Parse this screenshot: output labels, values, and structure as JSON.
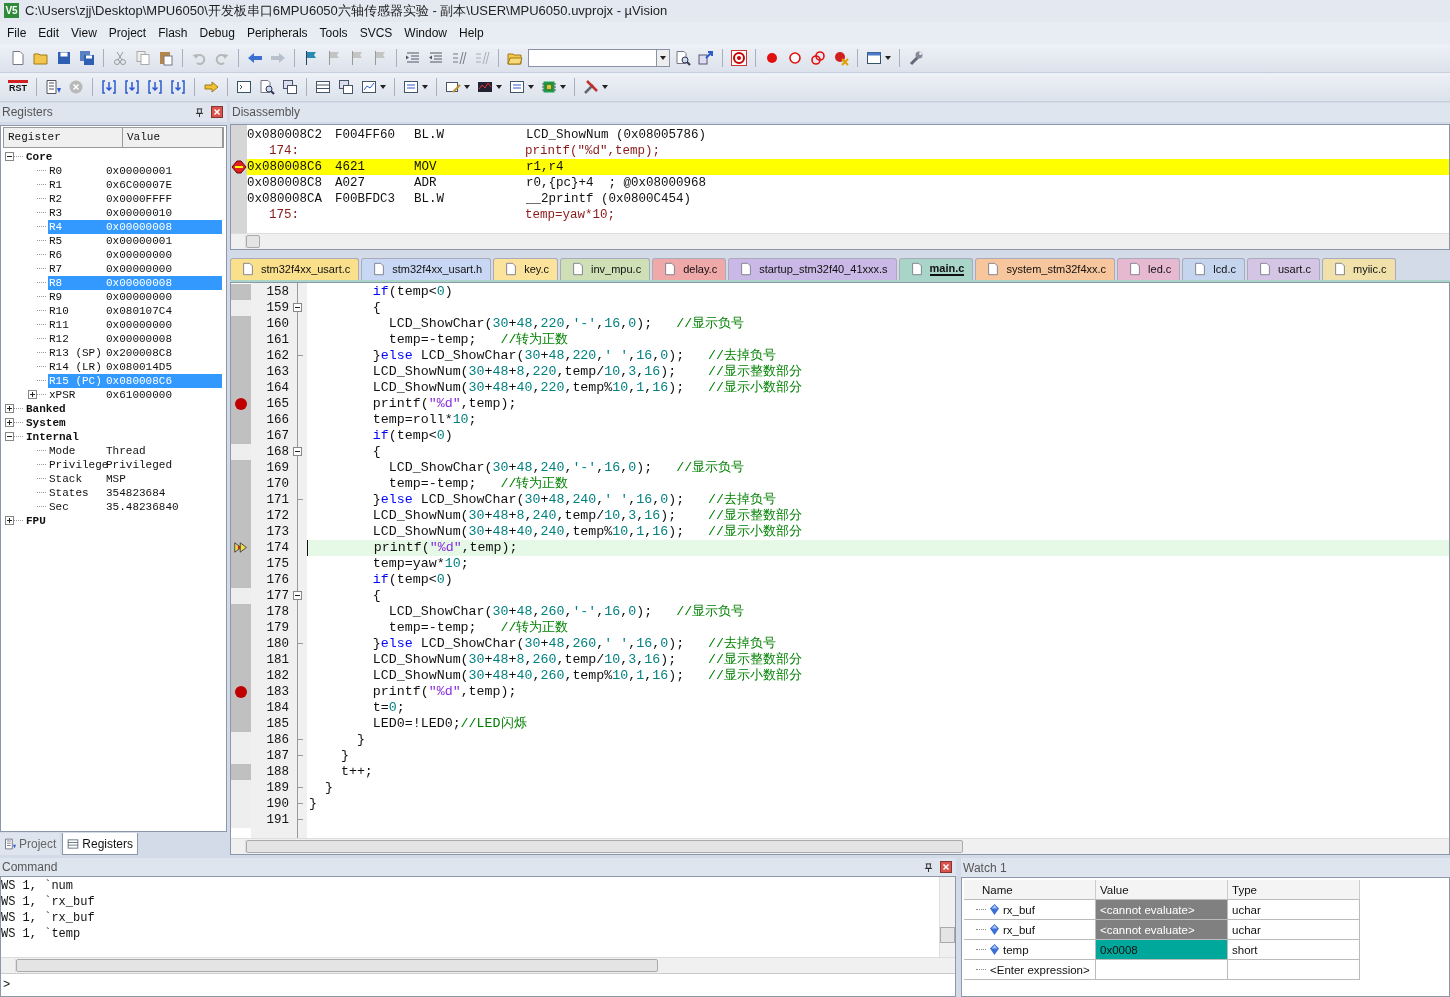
{
  "window": {
    "logo": "V5",
    "title": "C:\\Users\\zjj\\Desktop\\MPU6050\\开发板串口6MPU6050六轴传感器实验 - 副本\\USER\\MPU6050.uvprojx - µVision"
  },
  "menu": [
    "File",
    "Edit",
    "View",
    "Project",
    "Flash",
    "Debug",
    "Peripherals",
    "Tools",
    "SVCS",
    "Window",
    "Help"
  ],
  "toolbar_2": {
    "reset_label": "RST"
  },
  "registers_panel": {
    "title": "Registers",
    "columns": [
      "Register",
      "Value"
    ],
    "tree": [
      {
        "name": "Core",
        "expanded": true,
        "selected": false,
        "children": [
          {
            "name": "R0",
            "value": "0x00000001",
            "selected": false
          },
          {
            "name": "R1",
            "value": "0x6C00007E",
            "selected": false
          },
          {
            "name": "R2",
            "value": "0x0000FFFF",
            "selected": false
          },
          {
            "name": "R3",
            "value": "0x00000010",
            "selected": false
          },
          {
            "name": "R4",
            "value": "0x00000008",
            "selected": true
          },
          {
            "name": "R5",
            "value": "0x00000001",
            "selected": false
          },
          {
            "name": "R6",
            "value": "0x00000000",
            "selected": false
          },
          {
            "name": "R7",
            "value": "0x00000000",
            "selected": false
          },
          {
            "name": "R8",
            "value": "0x00000008",
            "selected": true
          },
          {
            "name": "R9",
            "value": "0x00000000",
            "selected": false
          },
          {
            "name": "R10",
            "value": "0x080107C4",
            "selected": false
          },
          {
            "name": "R11",
            "value": "0x00000000",
            "selected": false
          },
          {
            "name": "R12",
            "value": "0x00000008",
            "selected": false
          },
          {
            "name": "R13 (SP)",
            "value": "0x200008C8",
            "selected": false
          },
          {
            "name": "R14 (LR)",
            "value": "0x080014D5",
            "selected": false
          },
          {
            "name": "R15 (PC)",
            "value": "0x080008C6",
            "selected": true
          },
          {
            "name": "xPSR",
            "value": "0x61000000",
            "expanded": false,
            "selected": false
          }
        ]
      },
      {
        "name": "Banked",
        "expanded": false,
        "selected": false
      },
      {
        "name": "System",
        "expanded": false,
        "selected": false
      },
      {
        "name": "Internal",
        "expanded": true,
        "selected": false,
        "children": [
          {
            "name": "Mode",
            "value": "Thread",
            "selected": false
          },
          {
            "name": "Privilege",
            "value": "Privileged",
            "selected": false
          },
          {
            "name": "Stack",
            "value": "MSP",
            "selected": false
          },
          {
            "name": "States",
            "value": "354823684",
            "selected": false
          },
          {
            "name": "Sec",
            "value": "35.48236840",
            "selected": false
          }
        ]
      },
      {
        "name": "FPU",
        "expanded": false,
        "selected": false
      }
    ],
    "tabs": [
      {
        "label": "Project",
        "selected": false
      },
      {
        "label": "Registers",
        "selected": true
      }
    ]
  },
  "disassembly": {
    "title": "Disassembly",
    "rows": [
      {
        "kind": "asm",
        "address": "0x080008C2",
        "opcode": "F004FF60",
        "mnemonic": "BL.W",
        "operand": "LCD_ShowNum (0x08005786)",
        "current": false
      },
      {
        "kind": "source",
        "line": "174:",
        "text": "printf(\"%d\",temp);"
      },
      {
        "kind": "asm",
        "address": "0x080008C6",
        "opcode": "4621",
        "mnemonic": "MOV",
        "operand": "r1,r4",
        "current": true
      },
      {
        "kind": "asm",
        "address": "0x080008C8",
        "opcode": "A027",
        "mnemonic": "ADR",
        "operand": "r0,{pc}+4  ; @0x08000968",
        "current": false
      },
      {
        "kind": "asm",
        "address": "0x080008CA",
        "opcode": "F00BFDC3",
        "mnemonic": "BL.W",
        "operand": "__2printf (0x0800C454)",
        "current": false
      },
      {
        "kind": "source",
        "line": "175:",
        "text": "temp=yaw*10;"
      }
    ]
  },
  "editor": {
    "tabs": [
      {
        "label": "stm32f4xx_usart.c",
        "color": "#fbe08c",
        "selected": false
      },
      {
        "label": "stm32f4xx_usart.h",
        "color": "#c8d8f4",
        "selected": false
      },
      {
        "label": "key.c",
        "color": "#fce39c",
        "selected": false
      },
      {
        "label": "inv_mpu.c",
        "color": "#cfe0b6",
        "selected": false
      },
      {
        "label": "delay.c",
        "color": "#f0a9a9",
        "selected": false
      },
      {
        "label": "startup_stm32f40_41xxx.s",
        "color": "#cab9e6",
        "selected": false
      },
      {
        "label": "main.c",
        "color": "#a9d5c9",
        "selected": true
      },
      {
        "label": "system_stm32f4xx.c",
        "color": "#f8c69c",
        "selected": false
      },
      {
        "label": "led.c",
        "color": "#e6b9d1",
        "selected": false
      },
      {
        "label": "lcd.c",
        "color": "#c5d5ee",
        "selected": false
      },
      {
        "label": "usart.c",
        "color": "#d5c5e5",
        "selected": false
      },
      {
        "label": "myiic.c",
        "color": "#f0e1aa",
        "selected": false
      }
    ],
    "lines": [
      {
        "number": "158",
        "text": "        if(temp<0)",
        "executed": true,
        "breakpoint": false,
        "current": false
      },
      {
        "number": "159",
        "text": "        {",
        "executed": false,
        "breakpoint": false,
        "current": false,
        "fold_start": true
      },
      {
        "number": "160",
        "text": "          LCD_ShowChar(30+48,220,'-',16,0);   //显示负号",
        "executed": true,
        "breakpoint": false,
        "current": false
      },
      {
        "number": "161",
        "text": "          temp=-temp;   //转为正数",
        "executed": true,
        "breakpoint": false,
        "current": false
      },
      {
        "number": "162",
        "text": "        }else LCD_ShowChar(30+48,220,' ',16,0);   //去掉负号",
        "executed": true,
        "breakpoint": false,
        "current": false,
        "fold_end": true
      },
      {
        "number": "163",
        "text": "        LCD_ShowNum(30+48+8,220,temp/10,3,16);    //显示整数部分",
        "executed": true,
        "breakpoint": false,
        "current": false
      },
      {
        "number": "164",
        "text": "        LCD_ShowNum(30+48+40,220,temp%10,1,16);   //显示小数部分",
        "executed": true,
        "breakpoint": false,
        "current": false
      },
      {
        "number": "165",
        "text": "        printf(\"%d\",temp);",
        "executed": true,
        "breakpoint": true,
        "current": false
      },
      {
        "number": "166",
        "text": "        temp=roll*10;",
        "executed": true,
        "breakpoint": false,
        "current": false
      },
      {
        "number": "167",
        "text": "        if(temp<0)",
        "executed": true,
        "breakpoint": false,
        "current": false
      },
      {
        "number": "168",
        "text": "        {",
        "executed": false,
        "breakpoint": false,
        "current": false,
        "fold_start": true
      },
      {
        "number": "169",
        "text": "          LCD_ShowChar(30+48,240,'-',16,0);   //显示负号",
        "executed": true,
        "breakpoint": false,
        "current": false
      },
      {
        "number": "170",
        "text": "          temp=-temp;   //转为正数",
        "executed": true,
        "breakpoint": false,
        "current": false
      },
      {
        "number": "171",
        "text": "        }else LCD_ShowChar(30+48,240,' ',16,0);   //去掉负号",
        "executed": true,
        "breakpoint": false,
        "current": false,
        "fold_end": true
      },
      {
        "number": "172",
        "text": "        LCD_ShowNum(30+48+8,240,temp/10,3,16);    //显示整数部分",
        "executed": true,
        "breakpoint": false,
        "current": false
      },
      {
        "number": "173",
        "text": "        LCD_ShowNum(30+48+40,240,temp%10,1,16);   //显示小数部分",
        "executed": true,
        "breakpoint": false,
        "current": false
      },
      {
        "number": "174",
        "text": "        printf(\"%d\",temp);",
        "executed": true,
        "breakpoint": false,
        "current": true
      },
      {
        "number": "175",
        "text": "        temp=yaw*10;",
        "executed": true,
        "breakpoint": false,
        "current": false
      },
      {
        "number": "176",
        "text": "        if(temp<0)",
        "executed": true,
        "breakpoint": false,
        "current": false
      },
      {
        "number": "177",
        "text": "        {",
        "executed": false,
        "breakpoint": false,
        "current": false,
        "fold_start": true
      },
      {
        "number": "178",
        "text": "          LCD_ShowChar(30+48,260,'-',16,0);   //显示负号",
        "executed": true,
        "breakpoint": false,
        "current": false
      },
      {
        "number": "179",
        "text": "          temp=-temp;   //转为正数",
        "executed": true,
        "breakpoint": false,
        "current": false
      },
      {
        "number": "180",
        "text": "        }else LCD_ShowChar(30+48,260,' ',16,0);   //去掉负号",
        "executed": true,
        "breakpoint": false,
        "current": false,
        "fold_end": true
      },
      {
        "number": "181",
        "text": "        LCD_ShowNum(30+48+8,260,temp/10,3,16);    //显示整数部分",
        "executed": true,
        "breakpoint": false,
        "current": false
      },
      {
        "number": "182",
        "text": "        LCD_ShowNum(30+48+40,260,temp%10,1,16);   //显示小数部分",
        "executed": true,
        "breakpoint": false,
        "current": false
      },
      {
        "number": "183",
        "text": "        printf(\"%d\",temp);",
        "executed": true,
        "breakpoint": true,
        "current": false
      },
      {
        "number": "184",
        "text": "        t=0;",
        "executed": true,
        "breakpoint": false,
        "current": false
      },
      {
        "number": "185",
        "text": "        LED0=!LED0;//LED闪烁",
        "executed": true,
        "breakpoint": false,
        "current": false
      },
      {
        "number": "186",
        "text": "      }",
        "executed": false,
        "breakpoint": false,
        "current": false,
        "fold_end": true
      },
      {
        "number": "187",
        "text": "    }",
        "executed": false,
        "breakpoint": false,
        "current": false,
        "fold_end": true
      },
      {
        "number": "188",
        "text": "    t++;",
        "executed": true,
        "breakpoint": false,
        "current": false
      },
      {
        "number": "189",
        "text": "  }",
        "executed": false,
        "breakpoint": false,
        "current": false,
        "fold_end": true
      },
      {
        "number": "190",
        "text": "}",
        "executed": false,
        "breakpoint": false,
        "current": false,
        "fold_end": true
      },
      {
        "number": "191",
        "executed": false,
        "breakpoint": false,
        "current": false,
        "fold_end": true
      }
    ]
  },
  "command": {
    "title": "Command",
    "lines": [
      "WS 1, `num",
      "WS 1, `rx_buf",
      "WS 1, `rx_buf",
      "WS 1, `temp"
    ],
    "prompt": ">"
  },
  "watch": {
    "title": "Watch 1",
    "columns": [
      "Name",
      "Value",
      "Type"
    ],
    "rows": [
      {
        "name": "rx_buf",
        "value": "<cannot evaluate>",
        "type": "uchar",
        "error": true,
        "changed": false
      },
      {
        "name": "rx_buf",
        "value": "<cannot evaluate>",
        "type": "uchar",
        "error": true,
        "changed": false
      },
      {
        "name": "temp",
        "value": "0x0008",
        "type": "short",
        "error": false,
        "changed": true
      }
    ],
    "new_row": "<Enter expression>"
  }
}
